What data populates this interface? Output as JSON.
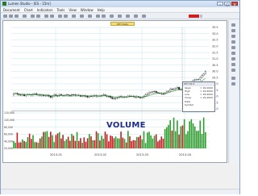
{
  "window": {
    "title": "Lumen Studio - [ES - 15m]"
  },
  "window_controls": {
    "minimize": "–",
    "maximize": "□",
    "close": "✕"
  },
  "menu": [
    "Document",
    "Chart",
    "Indicators",
    "Tools",
    "View",
    "Window",
    "Help"
  ],
  "chart": {
    "title": "WTI Daily",
    "volume_label": "VOLUME",
    "price_ticks": [
      "33.5",
      "33.0",
      "32.5",
      "32.0",
      "31.5",
      "31.0",
      "30.5",
      "30.0",
      "29.5",
      "29.0",
      "28.5",
      "28.0",
      "27.5",
      "27.0"
    ],
    "volume_ticks": [
      "110,000",
      "100,000",
      "80,000",
      "60,000",
      "40,000",
      "20,000"
    ],
    "date_ticks": [
      "2013-01",
      "2013-02",
      "2013-03",
      "2013-04"
    ],
    "info_box": {
      "header": "WTI 29.5",
      "rows": [
        {
          "label": "Open",
          "value": "= 29.0000"
        },
        {
          "label": "High",
          "value": "= 29.6000"
        },
        {
          "label": "Low",
          "value": "= 28.9000"
        },
        {
          "label": "Close",
          "value": "= 29.4000"
        }
      ],
      "footer": [
        "Date",
        "Symbol"
      ]
    }
  },
  "colors": {
    "up": "#2e9c2e",
    "down": "#c01e1e",
    "candle_up": "#ffffff",
    "candle_down": "#111111",
    "grid": "#c8e6ea"
  }
}
